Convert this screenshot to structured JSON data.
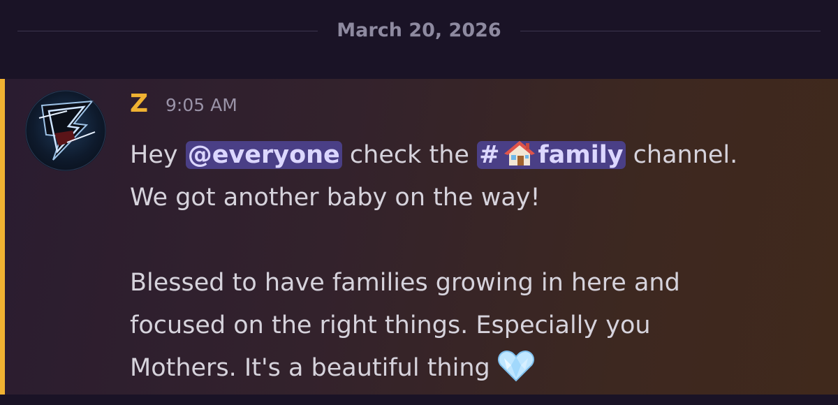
{
  "divider": {
    "date": "March 20, 2026"
  },
  "message": {
    "author": "Z",
    "timestamp": "9:05 AM",
    "line1_prefix": "Hey ",
    "mention": "@everyone",
    "line1_mid": " check the ",
    "channel_hash": "#",
    "channel_name": "family",
    "line1_suffix": " channel.",
    "line2": "We got another baby on the way!",
    "line3": "Blessed to have families growing in here and",
    "line4": "focused on the right things. Especially you",
    "line5": "Mothers. It's a beautiful thing",
    "icons": {
      "channel_emoji": "house-icon",
      "end_emoji": "light-blue-heart-icon"
    }
  },
  "colors": {
    "author_color": "#f0b232",
    "mention_bg": "#4a3f86",
    "mention_bar": "#f0b232"
  }
}
